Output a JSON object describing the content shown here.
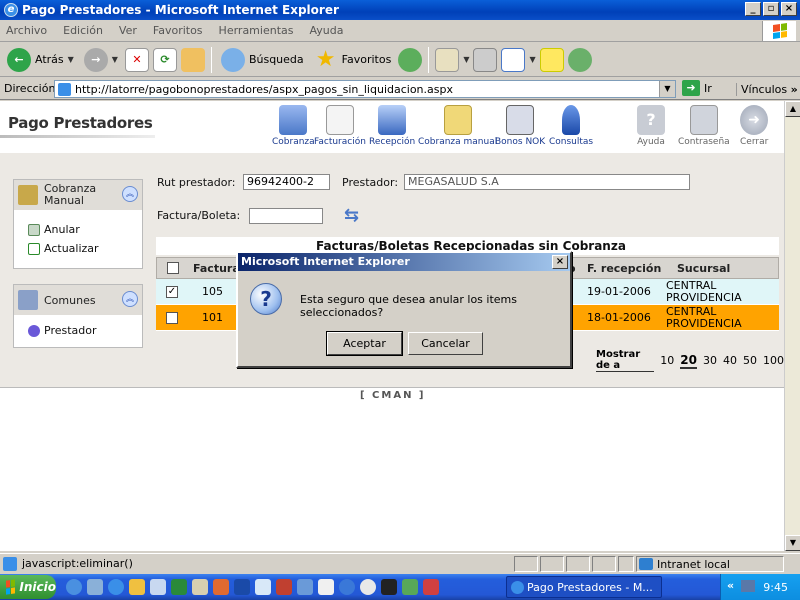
{
  "window": {
    "title": "Pago Prestadores - Microsoft Internet Explorer",
    "controls": [
      "_",
      "▫",
      "×"
    ]
  },
  "menu": [
    "Archivo",
    "Edición",
    "Ver",
    "Favoritos",
    "Herramientas",
    "Ayuda"
  ],
  "toolbar": {
    "back": "Atrás",
    "search": "Búsqueda",
    "favorites": "Favoritos"
  },
  "address": {
    "label": "Dirección",
    "url": "http://latorre/pagobonoprestadores/aspx_pagos_sin_liquidacion.aspx",
    "go": "Ir",
    "links": "Vínculos"
  },
  "app": {
    "brand": "Pago Prestadores",
    "nav": [
      "Cobranza",
      "Facturación",
      "Recepción",
      "Cobranza manual",
      "Bonos NOK",
      "Consultas"
    ],
    "nav_right": [
      "Ayuda",
      "Contraseña",
      "Cerrar"
    ],
    "colors": {
      "nav_text": "#1a3a8f",
      "row_selected": "#e0f6f8",
      "row_orange": "#ffa300"
    }
  },
  "sidebar": {
    "panel1": {
      "title": "Cobranza Manual",
      "items": [
        "Anular",
        "Actualizar"
      ]
    },
    "panel2": {
      "title": "Comunes",
      "items": [
        "Prestador"
      ]
    }
  },
  "form": {
    "rut_label": "Rut prestador:",
    "rut_value": "96942400-2",
    "prestador_label": "Prestador:",
    "prestador_value": "MEGASALUD S.A",
    "factura_label": "Factura/Boleta:",
    "factura_value": ""
  },
  "table": {
    "title": "Facturas/Boletas Recepcionadas sin Cobranza",
    "headers": [
      "Factura",
      "o",
      "F. recepción",
      "Sucursal"
    ],
    "rows": [
      {
        "checked": "✓",
        "factura": "105",
        "fecha": "19-01-2006",
        "sucursal1": "CENTRAL",
        "sucursal2": "PROVIDENCIA"
      },
      {
        "checked": "",
        "factura": "101",
        "fecha": "18-01-2006",
        "sucursal1": "CENTRAL",
        "sucursal2": "PROVIDENCIA"
      }
    ]
  },
  "paging": {
    "label": "Mostrar de a",
    "options": [
      "10",
      "20",
      "30",
      "40",
      "50",
      "100"
    ],
    "current": "20"
  },
  "footer": "[ CMAN ]",
  "dialog": {
    "title": "Microsoft Internet Explorer",
    "message": "Esta seguro que desea anular los items seleccionados?",
    "ok": "Aceptar",
    "cancel": "Cancelar"
  },
  "status": {
    "text": "javascript:eliminar()",
    "zone": "Intranet local"
  },
  "taskbar": {
    "start": "Inicio",
    "task": "Pago Prestadores - M...",
    "clock": "9:45"
  }
}
